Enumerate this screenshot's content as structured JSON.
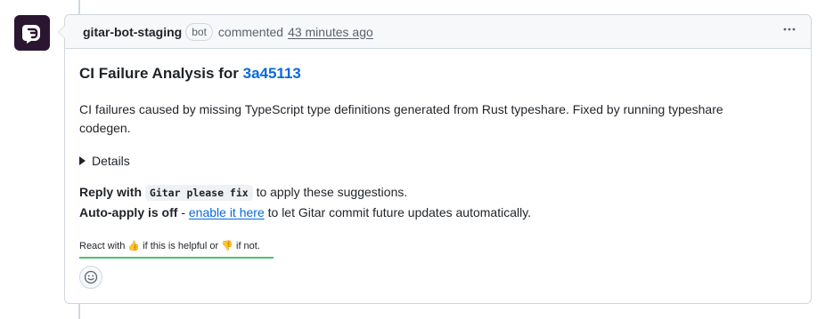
{
  "comment": {
    "author": "gitar-bot-staging",
    "badge": "bot",
    "action": "commented",
    "timestamp": "43 minutes ago",
    "menu_icon": "kebab-horizontal-icon"
  },
  "body": {
    "heading_prefix": "CI Failure Analysis for",
    "heading_sha": "3a45113",
    "summary": "CI failures caused by missing TypeScript type definitions generated from Rust typeshare. Fixed by running typeshare codegen.",
    "details_label": "Details",
    "reply_label": "Reply with",
    "reply_code": "Gitar please fix",
    "reply_suffix": "to apply these suggestions.",
    "auto_apply_label": "Auto-apply is off",
    "auto_apply_dash": "-",
    "auto_apply_link": "enable it here",
    "auto_apply_suffix": "to let Gitar commit future updates automatically.",
    "react_prefix": "React with",
    "react_thumbs_up": "👍",
    "react_middle": "if this is helpful or",
    "react_thumbs_down": "👎",
    "react_suffix": "if not."
  },
  "colors": {
    "link": "#0969da",
    "border": "#d0d7de",
    "header_bg": "#f6f8fa",
    "accent_underline": "#4ac26b",
    "avatar_bg": "#2b1631"
  }
}
